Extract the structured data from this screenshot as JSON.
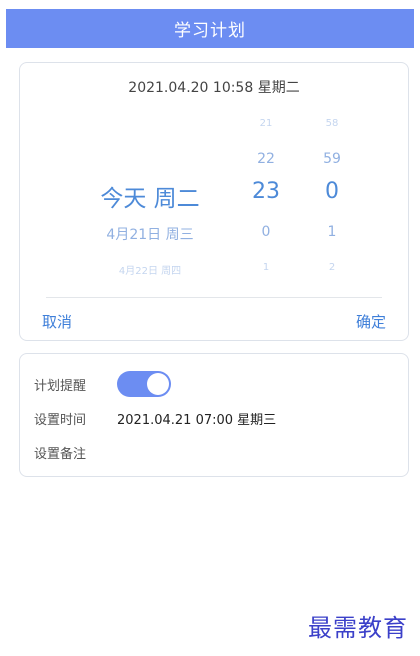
{
  "header": {
    "title": "学习计划"
  },
  "picker": {
    "current_datetime": "2021.04.20 10:58 星期二",
    "date_column": [
      "",
      "",
      "今天 周二",
      "4月21日 周三",
      "4月22日 周四"
    ],
    "hour_column": [
      "21",
      "22",
      "23",
      "0",
      "1"
    ],
    "minute_column": [
      "58",
      "59",
      "0",
      "1",
      "2"
    ],
    "cancel_label": "取消",
    "confirm_label": "确定"
  },
  "settings": {
    "reminder_label": "计划提醒",
    "reminder_enabled": true,
    "time_label": "设置时间",
    "time_value": "2021.04.21 07:00 星期三",
    "note_label": "设置备注",
    "note_value": ""
  },
  "watermark": "最需教育",
  "colors": {
    "header_bg": "#6c8df2",
    "accent": "#3f7fd9",
    "toggle_on": "#6c8df2"
  }
}
